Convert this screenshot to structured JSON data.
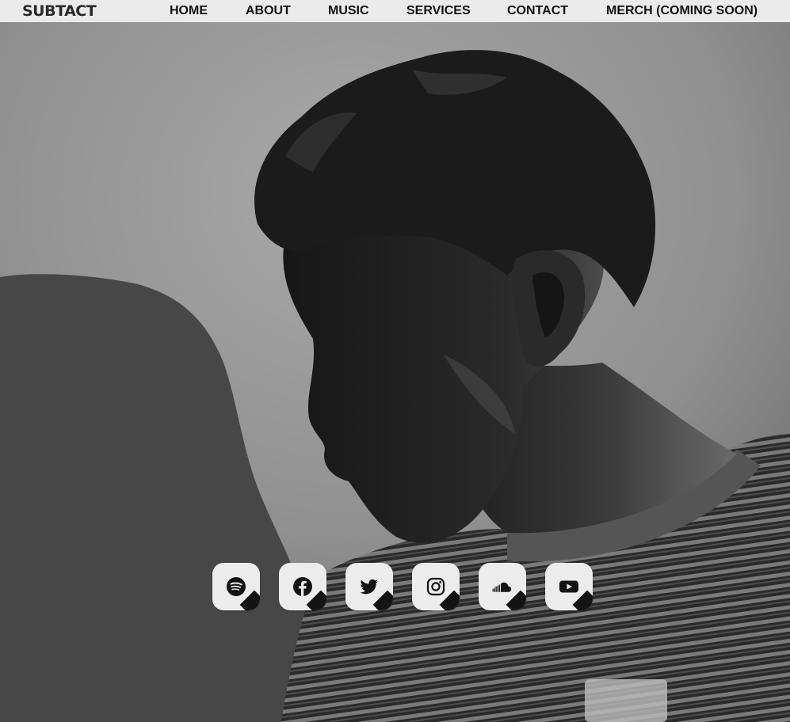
{
  "header": {
    "logo_text": "SUBTACT",
    "nav": [
      {
        "label": "HOME"
      },
      {
        "label": "ABOUT"
      },
      {
        "label": "MUSIC"
      },
      {
        "label": "SERVICES"
      },
      {
        "label": "CONTACT"
      },
      {
        "label": "MERCH (COMING SOON)"
      }
    ]
  },
  "social_links": [
    {
      "icon": "spotify-icon"
    },
    {
      "icon": "facebook-icon"
    },
    {
      "icon": "twitter-icon"
    },
    {
      "icon": "instagram-icon"
    },
    {
      "icon": "soundcloud-icon"
    },
    {
      "icon": "youtube-icon"
    }
  ],
  "colors": {
    "nav_background": "#ebebeb",
    "nav_text": "#111111",
    "button_background": "#ececec",
    "icon_color": "#141414"
  }
}
